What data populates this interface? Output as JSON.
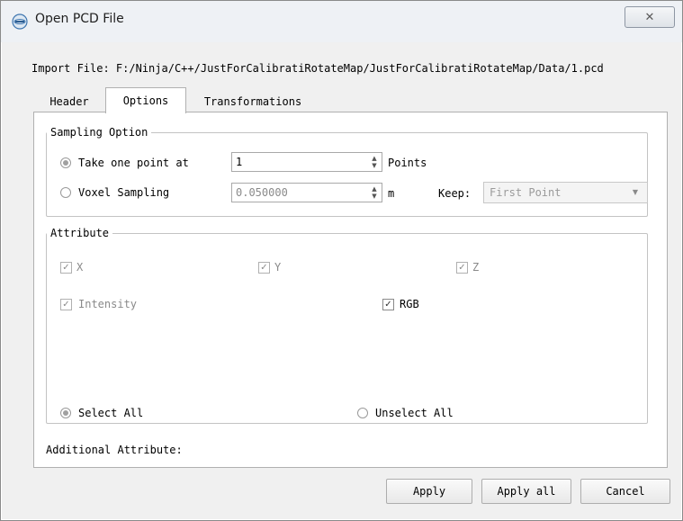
{
  "window": {
    "title": "Open PCD File",
    "close_glyph": "✕"
  },
  "import_file": {
    "text": "Import File: F:/Ninja/C++/JustForCalibratiRotateMap/JustForCalibratiRotateMap/Data/1.pcd"
  },
  "tabs": [
    {
      "label": "Header",
      "selected": false
    },
    {
      "label": "Options",
      "selected": true
    },
    {
      "label": "Transformations",
      "selected": false
    }
  ],
  "sampling": {
    "legend": "Sampling Option",
    "take_one_point": {
      "label": "Take one point at",
      "checked": true,
      "value": "1",
      "unit": "Points"
    },
    "voxel": {
      "label": "Voxel Sampling",
      "checked": false,
      "value": "0.050000",
      "unit": "m"
    },
    "keep": {
      "label": "Keep:",
      "value": "First Point"
    }
  },
  "attribute": {
    "legend": "Attribute",
    "x": {
      "label": "X",
      "checked": true,
      "enabled": false
    },
    "y": {
      "label": "Y",
      "checked": true,
      "enabled": false
    },
    "z": {
      "label": "Z",
      "checked": true,
      "enabled": false
    },
    "intensity": {
      "label": "Intensity",
      "checked": true,
      "enabled": false
    },
    "rgb": {
      "label": "RGB",
      "checked": true,
      "enabled": true
    },
    "select_all": {
      "label": "Select All",
      "checked": true
    },
    "unselect_all": {
      "label": "Unselect All",
      "checked": false
    }
  },
  "additional": {
    "label": "Additional Attribute:"
  },
  "buttons": {
    "apply": "Apply",
    "apply_all": "Apply all",
    "cancel": "Cancel"
  },
  "icons": {
    "spin_up": "▲",
    "spin_down": "▼",
    "dropdown": "▼",
    "check": "✓",
    "app": "point-cloud-app-icon"
  }
}
